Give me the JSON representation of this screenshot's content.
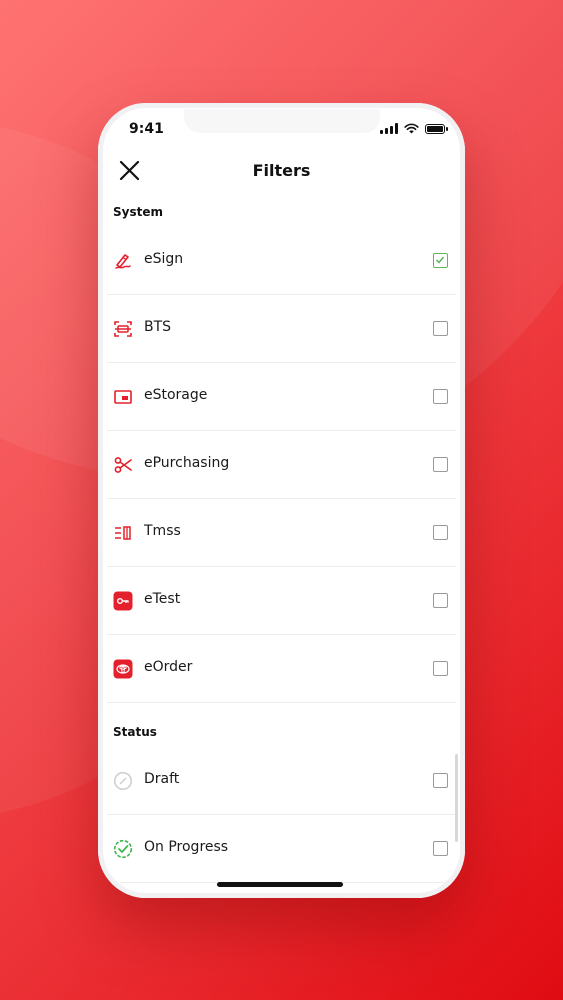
{
  "status_bar": {
    "time": "9:41"
  },
  "header": {
    "title": "Filters"
  },
  "sections": {
    "system": {
      "title": "System",
      "items": [
        {
          "label": "eSign",
          "icon": "pen-sign-icon",
          "checked": true
        },
        {
          "label": "BTS",
          "icon": "scan-frame-icon",
          "checked": false
        },
        {
          "label": "eStorage",
          "icon": "storage-window-icon",
          "checked": false
        },
        {
          "label": "ePurchasing",
          "icon": "scissors-icon",
          "checked": false
        },
        {
          "label": "Tmss",
          "icon": "list-columns-icon",
          "checked": false
        },
        {
          "label": "eTest",
          "icon": "key-badge-icon",
          "checked": false
        },
        {
          "label": "eOrder",
          "icon": "toyota-logo-icon",
          "checked": false
        }
      ]
    },
    "status": {
      "title": "Status",
      "items": [
        {
          "label": "Draft",
          "icon": "draft-circle-icon",
          "checked": false
        },
        {
          "label": "On Progress",
          "icon": "progress-check-icon",
          "checked": false
        }
      ]
    }
  },
  "colors": {
    "accent": "#e3202b",
    "check": "#5cb85c",
    "progress": "#3db54a"
  }
}
